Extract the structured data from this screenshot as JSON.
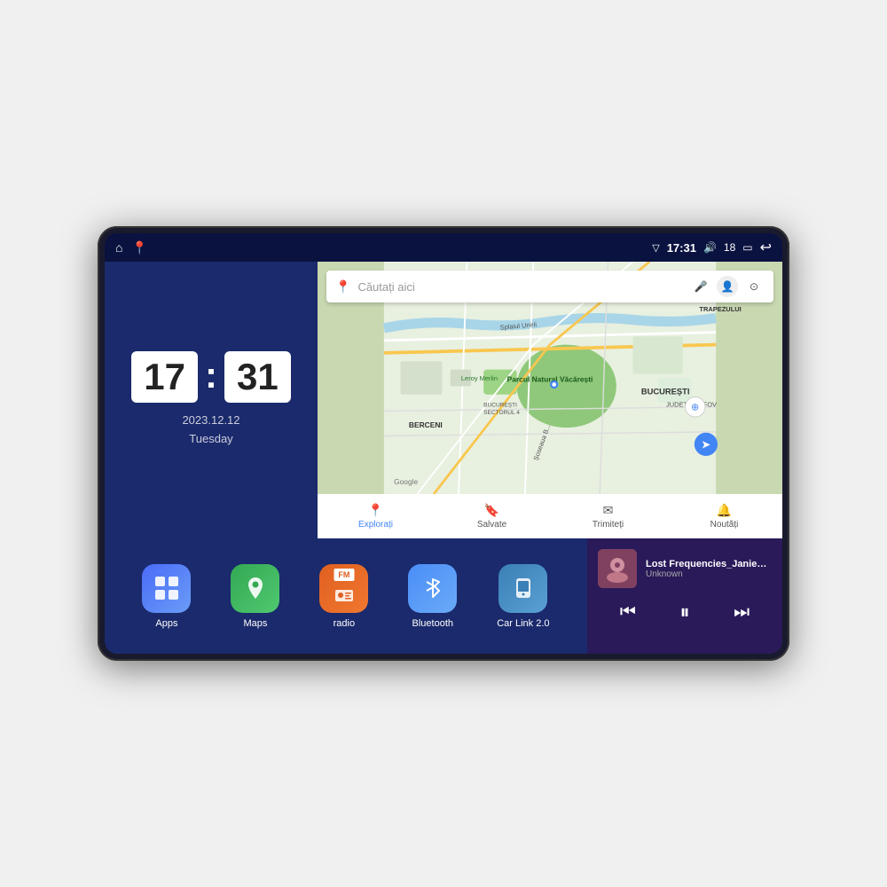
{
  "device": {
    "status_bar": {
      "left_icons": [
        "home",
        "maps"
      ],
      "time": "17:31",
      "signal_icon": "▽",
      "volume_icon": "🔊",
      "battery_level": "18",
      "battery_icon": "▭",
      "back_icon": "↩"
    },
    "clock": {
      "hours": "17",
      "minutes": "31",
      "date": "2023.12.12",
      "day": "Tuesday"
    },
    "map": {
      "search_placeholder": "Căutați aici",
      "nav_items": [
        {
          "label": "Explorați",
          "active": true
        },
        {
          "label": "Salvate",
          "active": false
        },
        {
          "label": "Trimiteți",
          "active": false
        },
        {
          "label": "Noutăți",
          "active": false
        }
      ],
      "labels": {
        "parcul": "Parcul Natural Văcărești",
        "leroy": "Leroy Merlin",
        "berceni": "BERCENI",
        "bucuresti": "BUCUREȘTI",
        "judet": "JUDEȚUL ILFOV",
        "sector4": "BUCUREȘTI SECTORUL 4",
        "trapezului": "TRAPEZULUI",
        "google": "Google",
        "splai": "Splaiul Unirii",
        "sosea": "Șoseaua B..."
      }
    },
    "apps": [
      {
        "id": "apps",
        "label": "Apps",
        "icon": "⊞",
        "color_class": "icon-apps"
      },
      {
        "id": "maps",
        "label": "Maps",
        "icon": "📍",
        "color_class": "icon-maps"
      },
      {
        "id": "radio",
        "label": "radio",
        "icon": "📻",
        "color_class": "icon-radio",
        "badge": "FM"
      },
      {
        "id": "bluetooth",
        "label": "Bluetooth",
        "icon": "⑁",
        "color_class": "icon-bluetooth"
      },
      {
        "id": "carlink",
        "label": "Car Link 2.0",
        "icon": "📱",
        "color_class": "icon-carlink"
      }
    ],
    "music": {
      "title": "Lost Frequencies_Janieck Devy-...",
      "artist": "Unknown",
      "controls": {
        "prev": "⏮",
        "play": "⏸",
        "next": "⏭"
      }
    }
  }
}
